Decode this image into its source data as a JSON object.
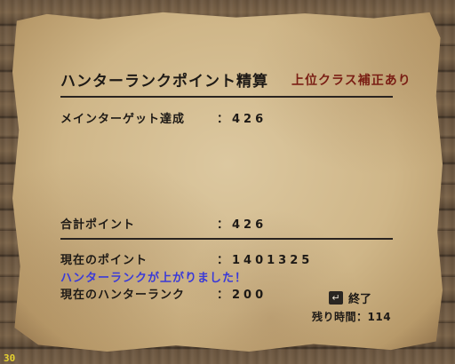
{
  "window": {
    "title": "ハンターランクポイント精算",
    "subtitle": "上位クラス補正あり"
  },
  "rows": {
    "main_target": {
      "label": "メインターゲット達成",
      "value": "：426"
    },
    "total": {
      "label": "合計ポイント",
      "value": "：426"
    },
    "current_points": {
      "label": "現在のポイント",
      "value": "：1401325"
    },
    "promotion_message": "ハンターランクが上がりました！",
    "current_rank": {
      "label": "現在のハンターランク",
      "value": "：200"
    }
  },
  "footer": {
    "end_label": "終了",
    "enter_icon": "enter-key-icon",
    "timer_text": "残り時間：114"
  },
  "overlay": {
    "fps": "30"
  },
  "colors": {
    "text": "#1e1a16",
    "subtitle": "#7a1e14",
    "promotion": "#3a3ad8",
    "fps": "#e6d230"
  }
}
